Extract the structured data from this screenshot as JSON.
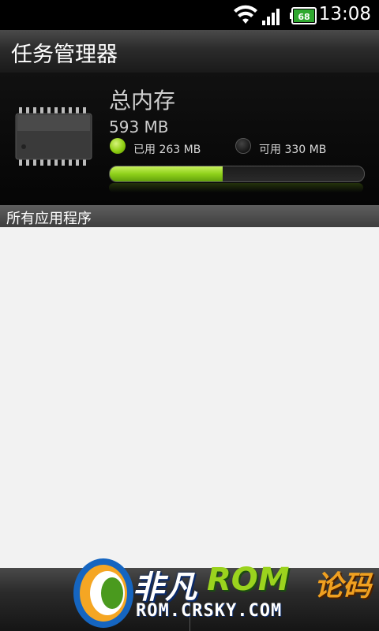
{
  "status_bar": {
    "time": "13:08",
    "battery_level": "68",
    "icons": [
      "wifi-icon",
      "signal-icon",
      "battery-icon"
    ]
  },
  "header": {
    "title": "任务管理器"
  },
  "memory": {
    "title": "总内存",
    "total": "593 MB",
    "used_label": "已用 263 MB",
    "free_label": "可用 330 MB",
    "used_fraction": 0.443,
    "used_color": "#8fcf12",
    "chip_icon": "memory-chip-icon"
  },
  "section": {
    "label": "所有应用程序"
  },
  "app_list": [],
  "watermark": {
    "brand_part1": "非凡",
    "brand_part2": "ROM",
    "brand_part3": "论码",
    "domain": "ROM.CRSKY.COM"
  }
}
